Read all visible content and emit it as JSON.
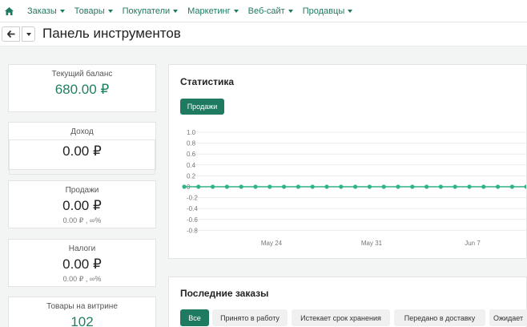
{
  "nav": {
    "home_icon": "home-icon",
    "items": [
      {
        "label": "Заказы"
      },
      {
        "label": "Товары"
      },
      {
        "label": "Покупатели"
      },
      {
        "label": "Маркетинг"
      },
      {
        "label": "Веб-сайт"
      },
      {
        "label": "Продавцы"
      }
    ]
  },
  "titlebar": {
    "back_icon": "arrow-left-icon",
    "title": "Панель инструментов"
  },
  "stats": {
    "balance": {
      "label": "Текущий баланс",
      "value": "680.00 ₽"
    },
    "income": {
      "label": "Доход",
      "value": "0.00 ₽"
    },
    "sales": {
      "label": "Продажи",
      "value": "0.00 ₽",
      "sub": "0.00 ₽ , ∞%"
    },
    "taxes": {
      "label": "Налоги",
      "value": "0.00 ₽",
      "sub": "0.00 ₽ , ∞%"
    },
    "products": {
      "label": "Товары на витрине",
      "value": "102"
    }
  },
  "statistics": {
    "title": "Статистика",
    "tab_sales": "Продажи"
  },
  "chart_data": {
    "type": "line",
    "y_ticks": [
      "1.0",
      "0.8",
      "0.6",
      "0.4",
      "0.2",
      "0",
      "-0.2",
      "-0.4",
      "-0.6",
      "-0.8"
    ],
    "ylim": [
      -0.8,
      1.0
    ],
    "x_tick_labels": [
      "May 24",
      "May 31",
      "Jun 7"
    ],
    "series": [
      {
        "values": [
          0,
          0,
          0,
          0,
          0,
          0,
          0,
          0,
          0,
          0,
          0,
          0,
          0,
          0,
          0,
          0,
          0,
          0,
          0,
          0,
          0,
          0,
          0,
          0,
          0
        ]
      }
    ],
    "line_color": "#2fb488",
    "grid": true
  },
  "recent_orders": {
    "title": "Последние заказы",
    "filters": [
      {
        "label": "Все"
      },
      {
        "label": "Принято в работу"
      },
      {
        "label": "Истекает срок хранения"
      },
      {
        "label": "Передано в доставку"
      },
      {
        "label": "Ожидает"
      }
    ]
  }
}
